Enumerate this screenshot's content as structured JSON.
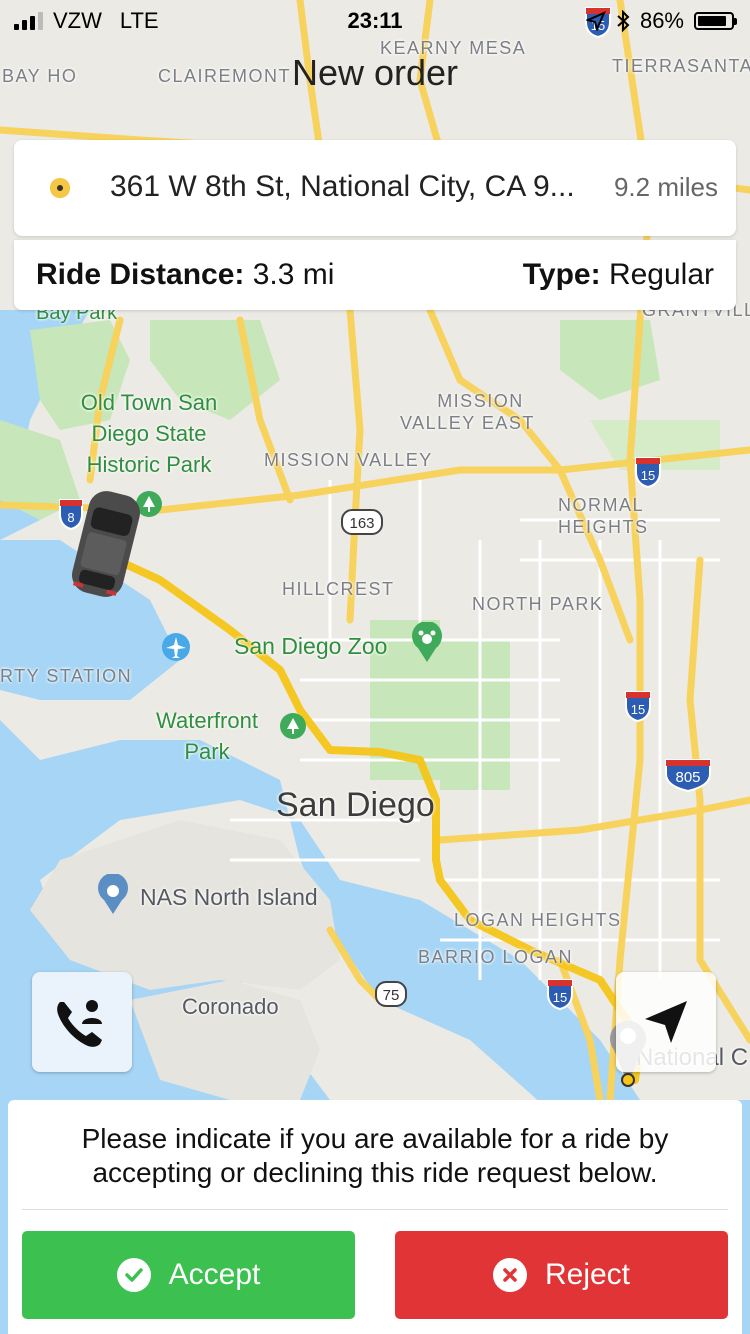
{
  "status_bar": {
    "carrier": "VZW",
    "network": "LTE",
    "time": "23:11",
    "battery_percent": "86%",
    "battery_level": 0.86
  },
  "nav": {
    "title": "New order"
  },
  "destination": {
    "address": "361 W 8th St, National City, CA 9...",
    "distance": "9.2 miles"
  },
  "ride": {
    "distance_label": "Ride Distance:",
    "distance_value": "3.3 mi",
    "type_label": "Type:",
    "type_value": "Regular"
  },
  "map": {
    "labels": {
      "bay_ho": "BAY HO",
      "clairemont": "CLAIREMONT",
      "kearny_mesa": "KEARNY MESA",
      "tierrasanta": "TIERRASANTA",
      "bay_park": "Bay Park",
      "grantville": "GRANTVILL",
      "old_town_1": "Old Town San",
      "old_town_2": "Diego State",
      "old_town_3": "Historic Park",
      "mission_valley_east_1": "MISSION",
      "mission_valley_east_2": "VALLEY EAST",
      "mission_valley": "MISSION VALLEY",
      "normal_heights_1": "NORMAL",
      "normal_heights_2": "HEIGHTS",
      "hillcrest": "HILLCREST",
      "north_park": "NORTH PARK",
      "liberty_station": "RTY STATION",
      "san_diego_zoo": "San Diego Zoo",
      "waterfront_1": "Waterfront",
      "waterfront_2": "Park",
      "san_diego": "San Diego",
      "nas_north_island": "NAS North Island",
      "logan_heights": "LOGAN HEIGHTS",
      "barrio_logan": "BARRIO LOGAN",
      "coronado": "Coronado",
      "national_city": "National C"
    },
    "shields": {
      "i8": "8",
      "i15_a": "15",
      "i15_b": "15",
      "i15_c": "15",
      "i15_top": "15",
      "i805": "805",
      "sr163": "163",
      "sr75": "75"
    },
    "colors": {
      "land": "#eceae4",
      "water": "#a6d5f5",
      "park": "#c7e6b9",
      "highway": "#f7d25c",
      "route": "#f5c518"
    }
  },
  "actions": {
    "call_icon": "phone-person-icon",
    "locate_icon": "navigation-arrow-icon"
  },
  "prompt": {
    "message": "Please indicate if you are available for a ride by accepting or declining this ride request below.",
    "accept_label": "Accept",
    "reject_label": "Reject",
    "accept_color": "#3cc150",
    "reject_color": "#e13436"
  }
}
